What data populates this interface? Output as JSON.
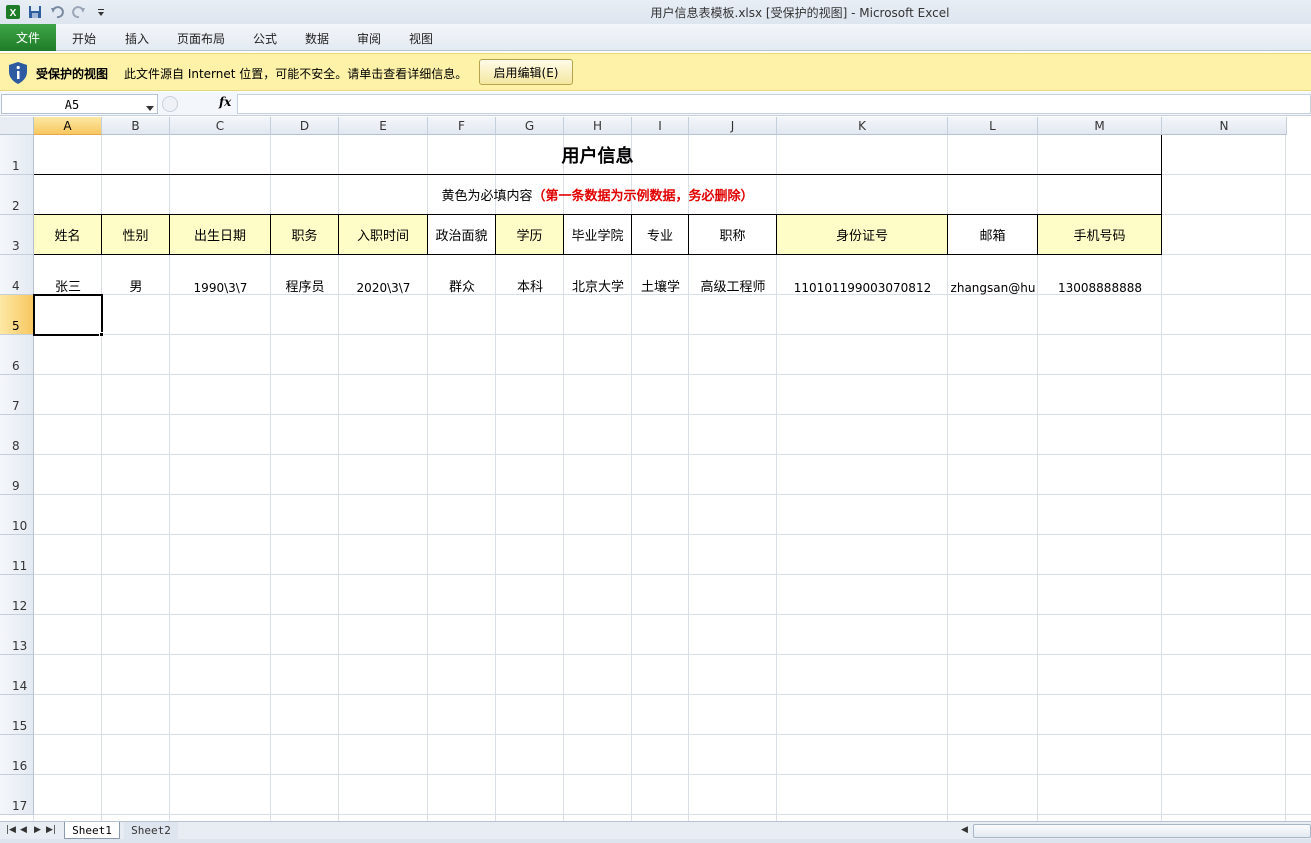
{
  "window": {
    "title": "用户信息表模板.xlsx  [受保护的视图]  -  Microsoft Excel"
  },
  "quick_access": {
    "icons": [
      "excel-logo-icon",
      "save-icon",
      "undo-icon",
      "redo-icon",
      "customize-icon"
    ]
  },
  "ribbon": {
    "file_tab": "文件",
    "tabs": [
      "开始",
      "插入",
      "页面布局",
      "公式",
      "数据",
      "审阅",
      "视图"
    ]
  },
  "protected_view": {
    "title": "受保护的视图",
    "message": "此文件源自 Internet 位置，可能不安全。请单击查看详细信息。",
    "button": "启用编辑(E)",
    "icon": "shield-info-icon",
    "color": "#fdf2a8"
  },
  "formula_bar": {
    "name_box": "A5",
    "fx": "fx",
    "value": ""
  },
  "columns": [
    "A",
    "B",
    "C",
    "D",
    "E",
    "F",
    "G",
    "H",
    "I",
    "J",
    "K",
    "L",
    "M",
    "N"
  ],
  "rows": [
    "1",
    "2",
    "3",
    "4",
    "5",
    "6",
    "7",
    "8",
    "9",
    "10",
    "11",
    "12",
    "13",
    "14",
    "15",
    "16",
    "17"
  ],
  "selected": {
    "column": "A",
    "row": "5"
  },
  "sheet": {
    "title": "用户信息",
    "subtitle_normal": "黄色为必填内容",
    "subtitle_red": "（第一条数据为示例数据，务必删除）",
    "headers": [
      "姓名",
      "性别",
      "出生日期",
      "职务",
      "入职时间",
      "政治面貌",
      "学历",
      "毕业学院",
      "专业",
      "职称",
      "身份证号",
      "邮箱",
      "手机号码"
    ],
    "yellow_headers": [
      true,
      true,
      true,
      true,
      true,
      false,
      true,
      false,
      false,
      false,
      true,
      false,
      true
    ],
    "example_row": [
      "张三",
      "男",
      "1990\\3\\7",
      "程序员",
      "2020\\3\\7",
      "群众",
      "本科",
      "北京大学",
      "土壤学",
      "高级工程师",
      "110101199003070812",
      "zhangsan@hu",
      "13008888888"
    ],
    "required_color": "#fffdc7",
    "warning_color": "#e00000"
  },
  "sheet_tabs": [
    "Sheet1",
    "Sheet2"
  ],
  "active_sheet": "Sheet1"
}
